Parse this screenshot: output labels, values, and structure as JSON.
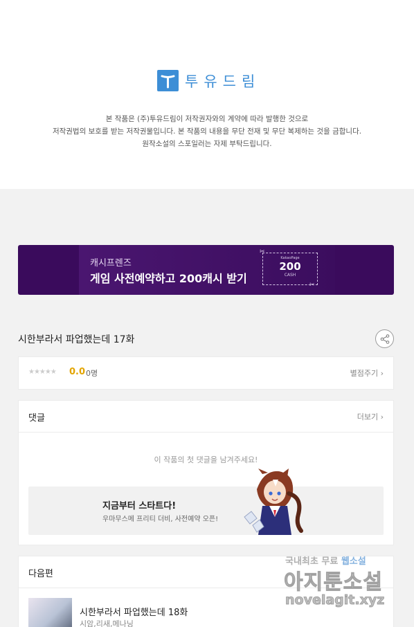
{
  "publisher": {
    "logo_text": "투유드림"
  },
  "notice": {
    "line1": "본 작품은 (주)투유드림이 저작권자와의 계약에 따라 발행한 것으로",
    "line2": "저작권법의 보호를 받는 저작권물입니다. 본 작품의 내용을 무단 전재 및 무단 복제하는 것을 금합니다.",
    "line3": "원작소설의 스포일러는 자제 부탁드립니다."
  },
  "banner": {
    "subtitle": "캐시프렌즈",
    "title": "게임 사전예약하고 200캐시 받기",
    "coupon_brand": "KakaoPage",
    "coupon_amount": "200",
    "coupon_unit": "CASH"
  },
  "episode": {
    "title": "시한부라서 파업했는데 17화"
  },
  "rating": {
    "stars": "★★★★★",
    "score": "0.0",
    "count": "0명",
    "rate_link": "별점주기 ›"
  },
  "comments": {
    "header": "댓글",
    "more": "더보기 ›",
    "empty_message": "이 작품의 첫 댓글을 남겨주세요!"
  },
  "ad": {
    "title": "지금부터 스타트다!",
    "subtitle": "우마무스메 프리티 더비, 사전예약 오픈!"
  },
  "next_episode": {
    "header": "다음편",
    "title": "시한부라서 파업했는데 18화",
    "author": "시암,리새,메나닝"
  },
  "watermark": {
    "line1_prefix": "국내최초 무료 ",
    "line1_highlight": "웹소설",
    "line2": "아지툰소설",
    "line3": "novelagit.xyz"
  },
  "colors": {
    "brand_blue": "#3d8ed6",
    "banner_purple": "#3a0b5c",
    "score_gold": "#e2a400"
  }
}
